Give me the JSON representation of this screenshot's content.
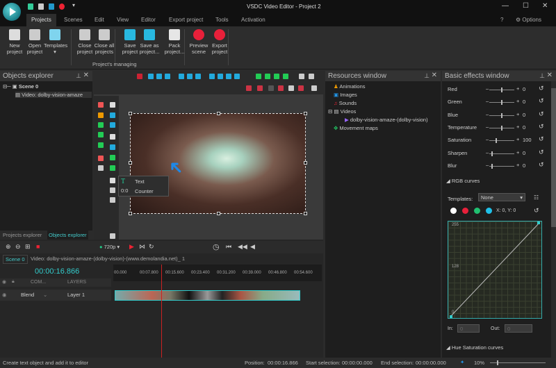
{
  "app": {
    "title": "VSDC Video Editor - Project 2",
    "options": "Options"
  },
  "menu_tabs": [
    "Projects",
    "Scenes",
    "Edit",
    "View",
    "Editor",
    "Export project",
    "Tools",
    "Activation"
  ],
  "ribbon": {
    "buttons": [
      {
        "label1": "New",
        "label2": "project",
        "icon": "new-project-icon",
        "color": "#dddddd"
      },
      {
        "label1": "Open",
        "label2": "project",
        "icon": "open-project-icon",
        "color": "#cccccc"
      },
      {
        "label1": "Templates",
        "label2": "▾",
        "icon": "templates-icon",
        "color": "#7fd4ee"
      },
      {
        "label1": "Close",
        "label2": "project",
        "icon": "close-project-icon",
        "color": "#cccccc"
      },
      {
        "label1": "Close all",
        "label2": "projects",
        "icon": "close-all-projects-icon",
        "color": "#cccccc"
      },
      {
        "label1": "Save",
        "label2": "project",
        "icon": "save-project-icon",
        "color": "#28b8e0"
      },
      {
        "label1": "Save as",
        "label2": "project...",
        "icon": "save-as-icon",
        "color": "#28b8e0"
      },
      {
        "label1": "Pack",
        "label2": "project...",
        "icon": "pack-project-icon",
        "color": "#e6e6e6"
      },
      {
        "label1": "Preview",
        "label2": "scene",
        "icon": "preview-scene-icon",
        "color": "#e8203a"
      },
      {
        "label1": "Export",
        "label2": "project",
        "icon": "export-project-icon",
        "color": "#e8203a"
      }
    ],
    "group_label": "Project's managing"
  },
  "objects_explorer": {
    "title": "Objects explorer",
    "scene": "Scene 0",
    "video": "Video: dolby-vision-amaze",
    "tabs": [
      "Projects explorer",
      "Objects explorer"
    ]
  },
  "popup_menu": {
    "items": [
      {
        "icon": "T",
        "label": "Text"
      },
      {
        "icon": "0:0",
        "label": "Counter"
      }
    ]
  },
  "resources": {
    "title": "Resources window",
    "items": [
      "Animations",
      "Images",
      "Sounds",
      "Videos",
      "dolby-vision-amaze-(dolby-vision)",
      "Movement maps"
    ]
  },
  "effects": {
    "title": "Basic effects window",
    "rows": [
      {
        "label": "Red",
        "value": "0",
        "pos": 0.5
      },
      {
        "label": "Green",
        "value": "0",
        "pos": 0.5
      },
      {
        "label": "Blue",
        "value": "0",
        "pos": 0.5
      },
      {
        "label": "Temperature",
        "value": "0",
        "pos": 0.5
      },
      {
        "label": "Saturation",
        "value": "100",
        "pos": 0.25
      },
      {
        "label": "Sharpen",
        "value": "0",
        "pos": 0.1
      },
      {
        "label": "Blur",
        "value": "0",
        "pos": 0.1
      }
    ],
    "rgb_curves": "RGB curves",
    "templates_label": "Templates:",
    "templates_value": "None",
    "coords": "X: 0, Y: 0",
    "curve_labels": [
      "255",
      "128",
      "0"
    ],
    "in_label": "In:",
    "out_label": "Out:",
    "in_value": "0",
    "out_value": "0",
    "hue_sat": "Hue Saturation curves",
    "channel_colors": [
      "#ffffff",
      "#e8203a",
      "#20c070",
      "#20c0e8"
    ]
  },
  "timeline": {
    "resolution": "720p",
    "tabs": [
      "Scene 0",
      "Video: dolby-vision-amaze-(dolby-vision)-(www.demolandia.net)_ 1"
    ],
    "time": "00:00:16.866",
    "ruler": [
      "00.000",
      "00:07.800",
      "00:15.600",
      "00:23.400",
      "00:31.200",
      "00:39.000",
      "00:46.800",
      "00:54.600"
    ],
    "header_com": "COM...",
    "header_layers": "LAYERS",
    "blend": "Blend",
    "layer": "Layer 1",
    "playhead_fraction": 0.23
  },
  "status": {
    "message": "Create text object and add it to editor",
    "position_label": "Position:",
    "position": "00:00:16.866",
    "start_label": "Start selection:",
    "start": "00:00:00.000",
    "end_label": "End selection:",
    "end": "00:00:00.000",
    "zoom": "10%"
  }
}
